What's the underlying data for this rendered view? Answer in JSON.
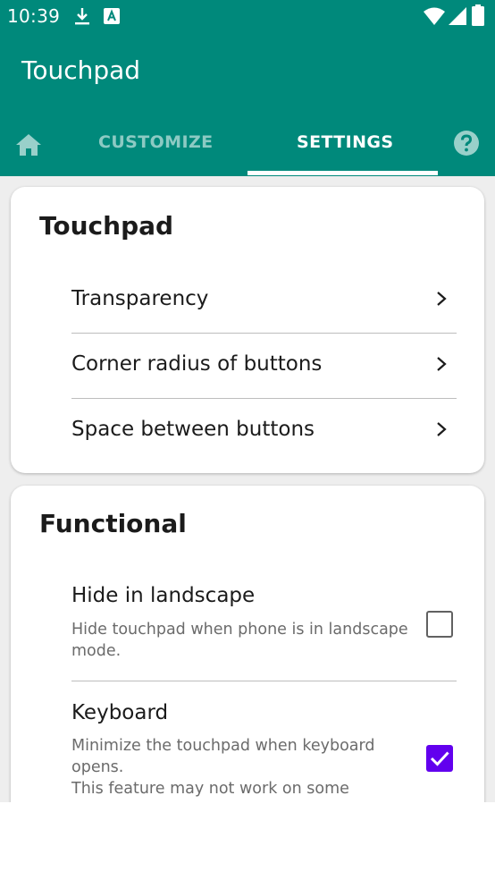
{
  "status_bar": {
    "time": "10:39",
    "left_icons": [
      "download-icon",
      "font-app-icon"
    ],
    "right_icons": [
      "wifi-icon",
      "cellular-signal-icon",
      "battery-icon"
    ]
  },
  "app_bar": {
    "title": "Touchpad",
    "color": "#00897b"
  },
  "tabs": {
    "items": [
      {
        "label": "",
        "icon": "home-icon"
      },
      {
        "label": "CUSTOMIZE"
      },
      {
        "label": "SETTINGS",
        "selected": true
      },
      {
        "label": "",
        "icon": "help-icon"
      }
    ]
  },
  "sections": {
    "touchpad": {
      "title": "Touchpad",
      "items": [
        {
          "label": "Transparency",
          "icon": "chevron-right-icon"
        },
        {
          "label": "Corner radius of buttons",
          "icon": "chevron-right-icon"
        },
        {
          "label": "Space between buttons",
          "icon": "chevron-right-icon"
        }
      ]
    },
    "functional": {
      "title": "Functional",
      "items": [
        {
          "title": "Hide in landscape",
          "summary": "Hide touchpad when phone is in landscape mode.",
          "checked": false
        },
        {
          "title": "Keyboard",
          "summary_line1": "Minimize the touchpad when keyboard opens.",
          "summary_line2": "This feature may not work on some",
          "checked": true
        }
      ]
    }
  },
  "colors": {
    "accent": "#00897b",
    "checkbox_checked": "#6200ee"
  }
}
